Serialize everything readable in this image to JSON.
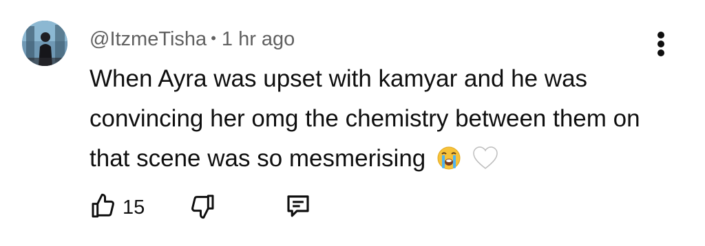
{
  "comment": {
    "author": "@ItzmeTisha",
    "separator": "•",
    "time": "1 hr ago",
    "text": "When Ayra was upset with kamyar and he was convincing her omg the chemistry between them on that scene was so mesmerising",
    "emojis": [
      "loudly-crying-face-emoji",
      "white-heart-emoji"
    ]
  },
  "actions": {
    "like_icon": "thumbs-up-icon",
    "like_count": "15",
    "dislike_icon": "thumbs-down-icon",
    "reply_icon": "comment-reply-icon"
  },
  "menu_icon": "more-vertical-icon"
}
